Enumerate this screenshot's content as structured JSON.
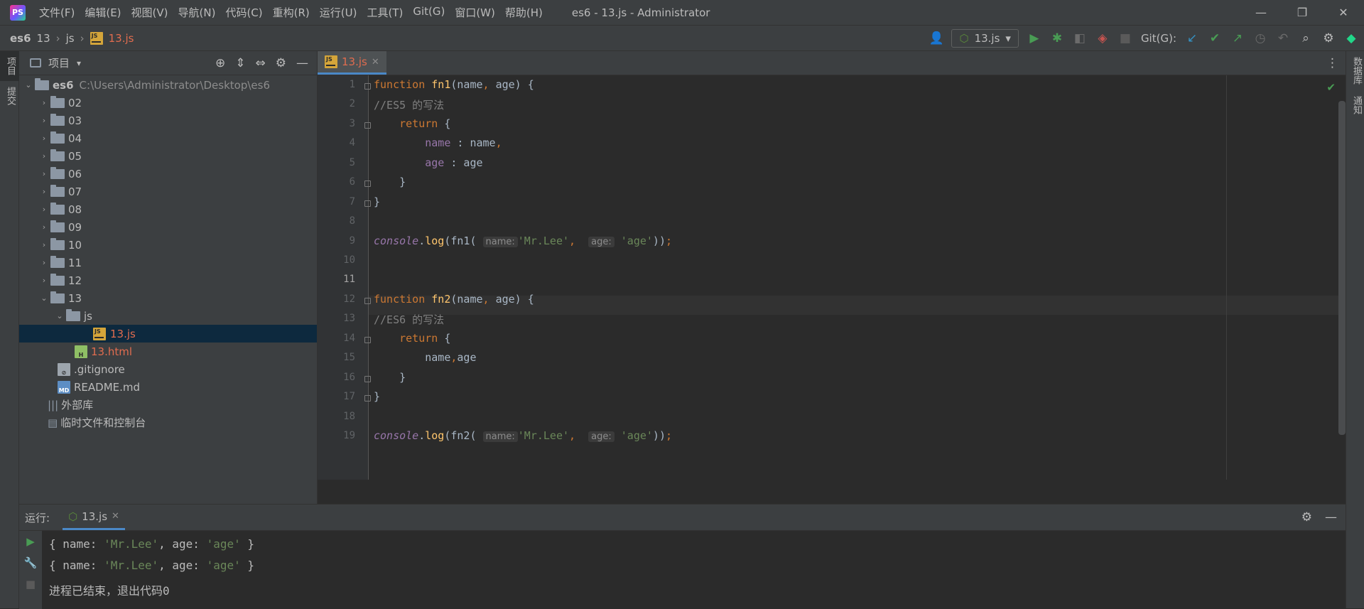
{
  "title": {
    "menus": [
      "文件(F)",
      "编辑(E)",
      "视图(V)",
      "导航(N)",
      "代码(C)",
      "重构(R)",
      "运行(U)",
      "工具(T)",
      "Git(G)",
      "窗口(W)",
      "帮助(H)"
    ],
    "window_title": "es6 - 13.js - Administrator"
  },
  "breadcrumb": {
    "root": "es6",
    "p1": "13",
    "p2": "js",
    "file": "13.js"
  },
  "toolbar": {
    "run_config": "13.js",
    "git_label": "Git(G):"
  },
  "left_strip": {
    "project": "项目",
    "commit": "提交"
  },
  "right_strip": {
    "database": "数据库",
    "notifications": "通知"
  },
  "project": {
    "title": "项目",
    "root": {
      "name": "es6",
      "path": "C:\\Users\\Administrator\\Desktop\\es6"
    },
    "folders": [
      "02",
      "03",
      "04",
      "05",
      "06",
      "07",
      "08",
      "09",
      "10",
      "11",
      "12"
    ],
    "folder13": "13",
    "sub_js": "js",
    "file_js": "13.js",
    "file_html": "13.html",
    "gitignore": ".gitignore",
    "readme": "README.md",
    "ext_libs": "外部库",
    "scratches": "临时文件和控制台"
  },
  "editor": {
    "tab": "13.js",
    "line_numbers": [
      "1",
      "2",
      "3",
      "4",
      "5",
      "6",
      "7",
      "8",
      "9",
      "10",
      "11",
      "12",
      "13",
      "14",
      "15",
      "16",
      "17",
      "18",
      "19"
    ],
    "hint_name": "name:",
    "hint_age": "age:"
  },
  "run": {
    "label": "运行:",
    "tab": "13.js",
    "output": [
      "{ name: 'Mr.Lee', age: 'age' }",
      "{ name: 'Mr.Lee', age: 'age' }"
    ],
    "exit": "进程已结束，退出代码0"
  },
  "colors": {
    "accent": "#4a88c7",
    "keyword": "#cc7832",
    "string": "#6a8759",
    "property": "#9876aa"
  }
}
